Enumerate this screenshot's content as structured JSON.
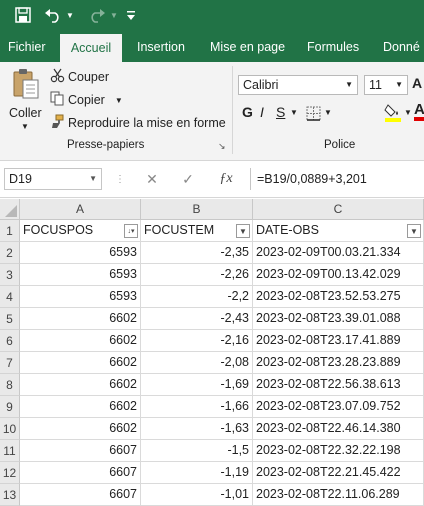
{
  "tabs": [
    "Fichier",
    "Accueil",
    "Insertion",
    "Mise en page",
    "Formules",
    "Donné"
  ],
  "clipboard": {
    "paste_label": "Coller",
    "cut_label": "Couper",
    "copy_label": "Copier",
    "format_painter_label": "Reproduire la mise en forme",
    "group_label": "Presse-papiers"
  },
  "font": {
    "name": "Calibri",
    "size": "11",
    "group_label": "Police"
  },
  "formula_bar": {
    "name_box": "D19",
    "formula": "=B19/0,0889+3,201"
  },
  "columns": [
    "A",
    "B",
    "C"
  ],
  "headers": [
    "FOCUSPOS",
    "FOCUSTEM",
    "DATE-OBS"
  ],
  "row_numbers": [
    "1",
    "2",
    "3",
    "4",
    "5",
    "6",
    "7",
    "8",
    "9",
    "10",
    "11",
    "12",
    "13"
  ],
  "rows": [
    [
      "6593",
      "-2,35",
      "2023-02-09T00.03.21.334"
    ],
    [
      "6593",
      "-2,26",
      "2023-02-09T00.13.42.029"
    ],
    [
      "6593",
      "-2,2",
      "2023-02-08T23.52.53.275"
    ],
    [
      "6602",
      "-2,43",
      "2023-02-08T23.39.01.088"
    ],
    [
      "6602",
      "-2,16",
      "2023-02-08T23.17.41.889"
    ],
    [
      "6602",
      "-2,08",
      "2023-02-08T23.28.23.889"
    ],
    [
      "6602",
      "-1,69",
      "2023-02-08T22.56.38.613"
    ],
    [
      "6602",
      "-1,66",
      "2023-02-08T23.07.09.752"
    ],
    [
      "6602",
      "-1,63",
      "2023-02-08T22.46.14.380"
    ],
    [
      "6607",
      "-1,5",
      "2023-02-08T22.32.22.198"
    ],
    [
      "6607",
      "-1,19",
      "2023-02-08T22.21.45.422"
    ],
    [
      "6607",
      "-1,01",
      "2023-02-08T22.11.06.289"
    ]
  ],
  "colors": {
    "accent": "#217346"
  }
}
